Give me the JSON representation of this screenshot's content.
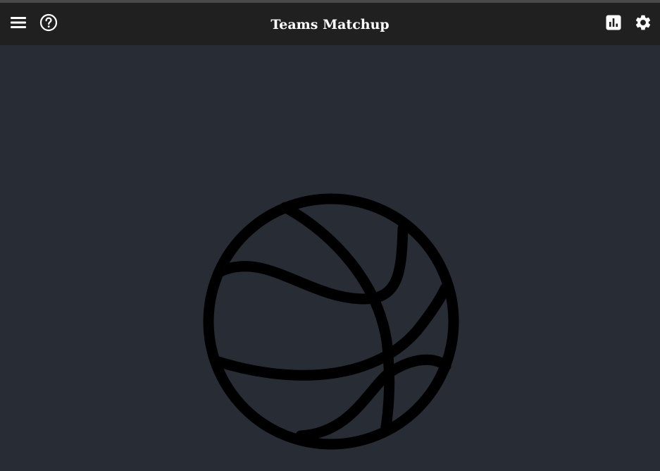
{
  "header": {
    "title": "Teams Matchup",
    "left_icons": [
      "menu-icon",
      "help-icon"
    ],
    "right_icons": [
      "stats-icon",
      "settings-icon"
    ]
  },
  "main": {
    "illustration": "basketball-icon"
  },
  "colors": {
    "header_bg": "#202020",
    "page_bg": "#282c35",
    "icon": "#ffffff",
    "ball_stroke": "#000000"
  }
}
